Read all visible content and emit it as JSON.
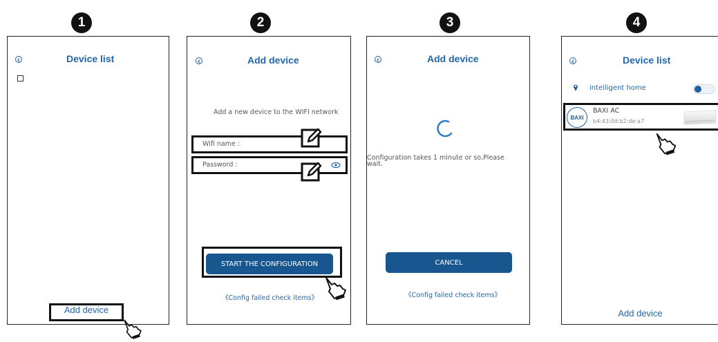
{
  "steps": [
    {
      "number": "1"
    },
    {
      "number": "2"
    },
    {
      "number": "3"
    },
    {
      "number": "4"
    }
  ],
  "screen1": {
    "title": "Device list",
    "add_device_label": "Add device"
  },
  "screen2": {
    "title": "Add device",
    "instruction": "Add a new device to the WIFI network",
    "wifi_label": "Wifi name :",
    "password_label": "Password :",
    "start_button_label": "START THE CONFIGURATION",
    "config_failed_link": "《Config failed check items》"
  },
  "screen3": {
    "title": "Add device",
    "message_line1": "Configuration takes 1 minute or so,Please",
    "message_line2": "wait.",
    "cancel_label": "CANCEL",
    "config_failed_link": "《Config failed check items》"
  },
  "screen4": {
    "title": "Device list",
    "home_name": "intelligent home",
    "device_brand_logo": "BAXI",
    "device_name": "BAXI AC",
    "device_mac": "b4:43:0d:b2:de:a7",
    "add_device_label": "Add device"
  },
  "colors": {
    "accent": "#2266aa",
    "button": "#17568f"
  }
}
